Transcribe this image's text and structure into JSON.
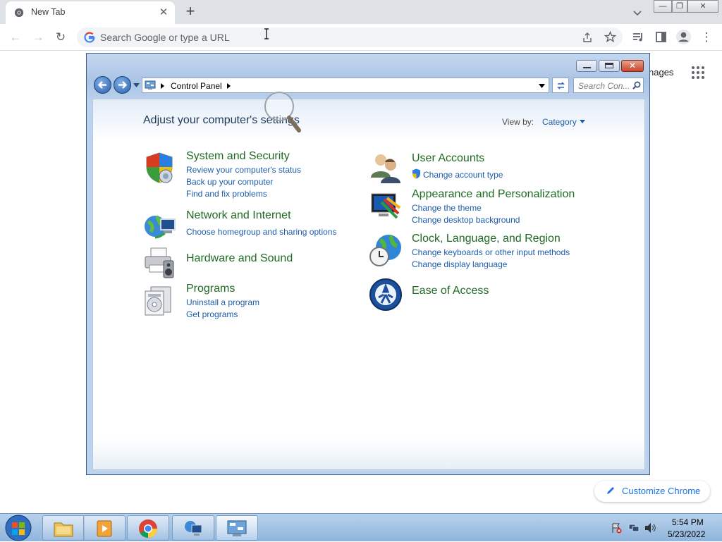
{
  "browser": {
    "tab_title": "New Tab",
    "tab_close": "✕",
    "new_tab": "+",
    "omnibox_placeholder": "Search Google or type a URL",
    "window_min": "—",
    "window_restore": "❐",
    "window_close": "✕"
  },
  "ntp": {
    "images_link": "nages",
    "customize_label": "Customize Chrome"
  },
  "control_panel": {
    "breadcrumb": "Control Panel",
    "search_placeholder": "Search Con...",
    "heading": "Adjust your computer's settings",
    "view_by_label": "View by:",
    "view_by_value": "Category",
    "categories_left": [
      {
        "title": "System and Security",
        "icon": "shield-icon",
        "links": [
          "Review your computer's status",
          "Back up your computer",
          "Find and fix problems"
        ]
      },
      {
        "title": "Network and Internet",
        "icon": "network-globe-icon",
        "links": [
          "Choose homegroup and sharing options"
        ]
      },
      {
        "title": "Hardware and Sound",
        "icon": "printer-icon",
        "links": []
      },
      {
        "title": "Programs",
        "icon": "programs-icon",
        "links": [
          "Uninstall a program",
          "Get programs"
        ]
      }
    ],
    "categories_right": [
      {
        "title": "User Accounts",
        "icon": "users-icon",
        "links": [
          "Change account type"
        ]
      },
      {
        "title": "Appearance and Personalization",
        "icon": "monitor-paint-icon",
        "links": [
          "Change the theme",
          "Change desktop background"
        ]
      },
      {
        "title": "Clock, Language, and Region",
        "icon": "clock-globe-icon",
        "links": [
          "Change keyboards or other input methods",
          "Change display language"
        ]
      },
      {
        "title": "Ease of Access",
        "icon": "ease-of-access-icon",
        "links": []
      }
    ]
  },
  "taskbar": {
    "time": "5:54 PM",
    "date": "5/23/2022"
  },
  "colors": {
    "cp_title_green": "#1e6b23",
    "cp_link_blue": "#1c5daa",
    "chrome_blue": "#1a73e8"
  }
}
